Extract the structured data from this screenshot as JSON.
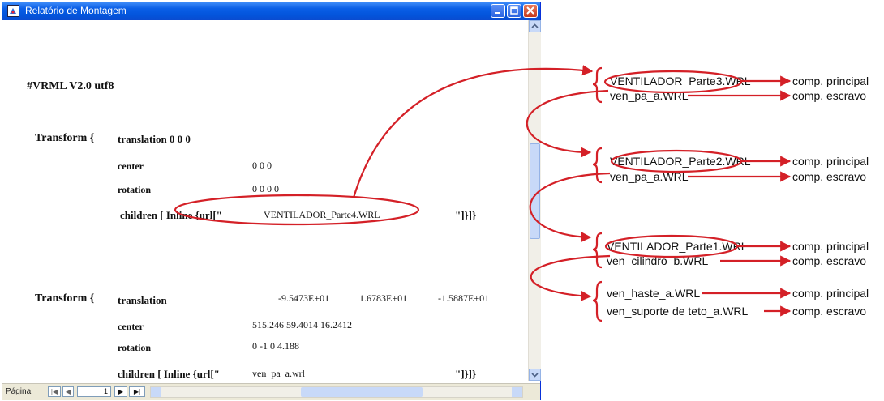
{
  "window": {
    "title": "Relatório de Montagem",
    "icon": "report-app-icon"
  },
  "report": {
    "header": "#VRML V2.0 utf8",
    "transform1": {
      "keyword": "Transform {",
      "translation_label": "translation 0 0 0",
      "center_label": "center",
      "center_value": "0 0 0",
      "rotation_label": "rotation",
      "rotation_value": "0 0 0     0",
      "children_label": "children [ Inline {url[\"",
      "children_value": "VENTILADOR_Parte4.WRL",
      "children_close": "\"]}]}"
    },
    "transform2": {
      "keyword": "Transform {",
      "translation_label": "translation",
      "translation_x": "-9.5473E+01",
      "translation_y": "1.6783E+01",
      "translation_z": "-1.5887E+01",
      "center_label": "center",
      "center_value": "515.246 59.4014 16.2412",
      "rotation_label": "rotation",
      "rotation_value": "0 -1 0    4.188",
      "children_label": "children [ Inline {url[\"",
      "children_value": "ven_pa_a.wrl",
      "children_close": "\"]}]}"
    }
  },
  "statusbar": {
    "page_label": "Página:",
    "page_value": "1"
  },
  "groups": [
    {
      "items": [
        {
          "file": "VENTILADOR_Parte3.WRL",
          "role": "comp. principal"
        },
        {
          "file": "ven_pa_a.WRL",
          "role": "comp. escravo"
        }
      ]
    },
    {
      "items": [
        {
          "file": "VENTILADOR_Parte2.WRL",
          "role": "comp. principal"
        },
        {
          "file": "ven_pa_a.WRL",
          "role": "comp. escravo"
        }
      ]
    },
    {
      "items": [
        {
          "file": "VENTILADOR_Parte1.WRL",
          "role": "comp. principal"
        },
        {
          "file": "ven_cilindro_b.WRL",
          "role": "comp. escravo"
        }
      ]
    },
    {
      "items": [
        {
          "file": "ven_haste_a.WRL",
          "role": "comp. principal"
        },
        {
          "file": "ven_suporte de teto_a.WRL",
          "role": "comp. escravo"
        }
      ]
    }
  ],
  "colors": {
    "annotation": "#d42027",
    "titlebar": "#0a5ee6"
  }
}
